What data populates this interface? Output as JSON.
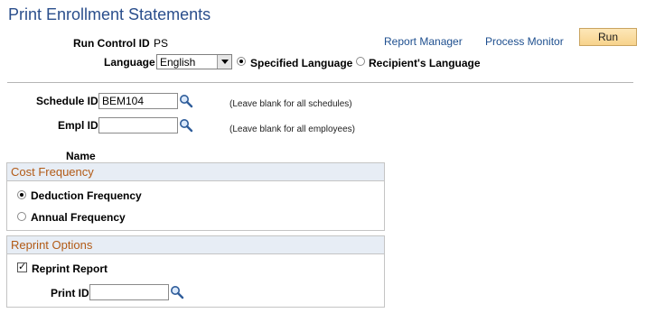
{
  "page": {
    "title": "Print Enrollment Statements"
  },
  "header": {
    "run_control_label": "Run Control ID",
    "run_control_value": "PS",
    "language_label": "Language",
    "language_value": "English",
    "specified_language_label": "Specified Language",
    "recipients_language_label": "Recipient's Language",
    "specified_language_selected": true,
    "report_manager_link": "Report Manager",
    "process_monitor_link": "Process Monitor",
    "run_button_label": "Run"
  },
  "form": {
    "schedule_id_label": "Schedule ID",
    "schedule_id_value": "BEM104",
    "schedule_hint": "(Leave blank for all schedules)",
    "empl_id_label": "Empl ID",
    "empl_id_value": "",
    "empl_hint": "(Leave blank for all employees)",
    "name_label": "Name"
  },
  "cost_frequency": {
    "heading": "Cost Frequency",
    "options": [
      {
        "label": "Deduction Frequency",
        "selected": true
      },
      {
        "label": "Annual Frequency",
        "selected": false
      }
    ]
  },
  "reprint_options": {
    "heading": "Reprint Options",
    "reprint_report_label": "Reprint Report",
    "reprint_report_checked": true,
    "print_id_label": "Print ID",
    "print_id_value": ""
  },
  "icons": {
    "lookup": "magnifier-lookup-icon",
    "dropdown": "chevron-down-icon"
  }
}
